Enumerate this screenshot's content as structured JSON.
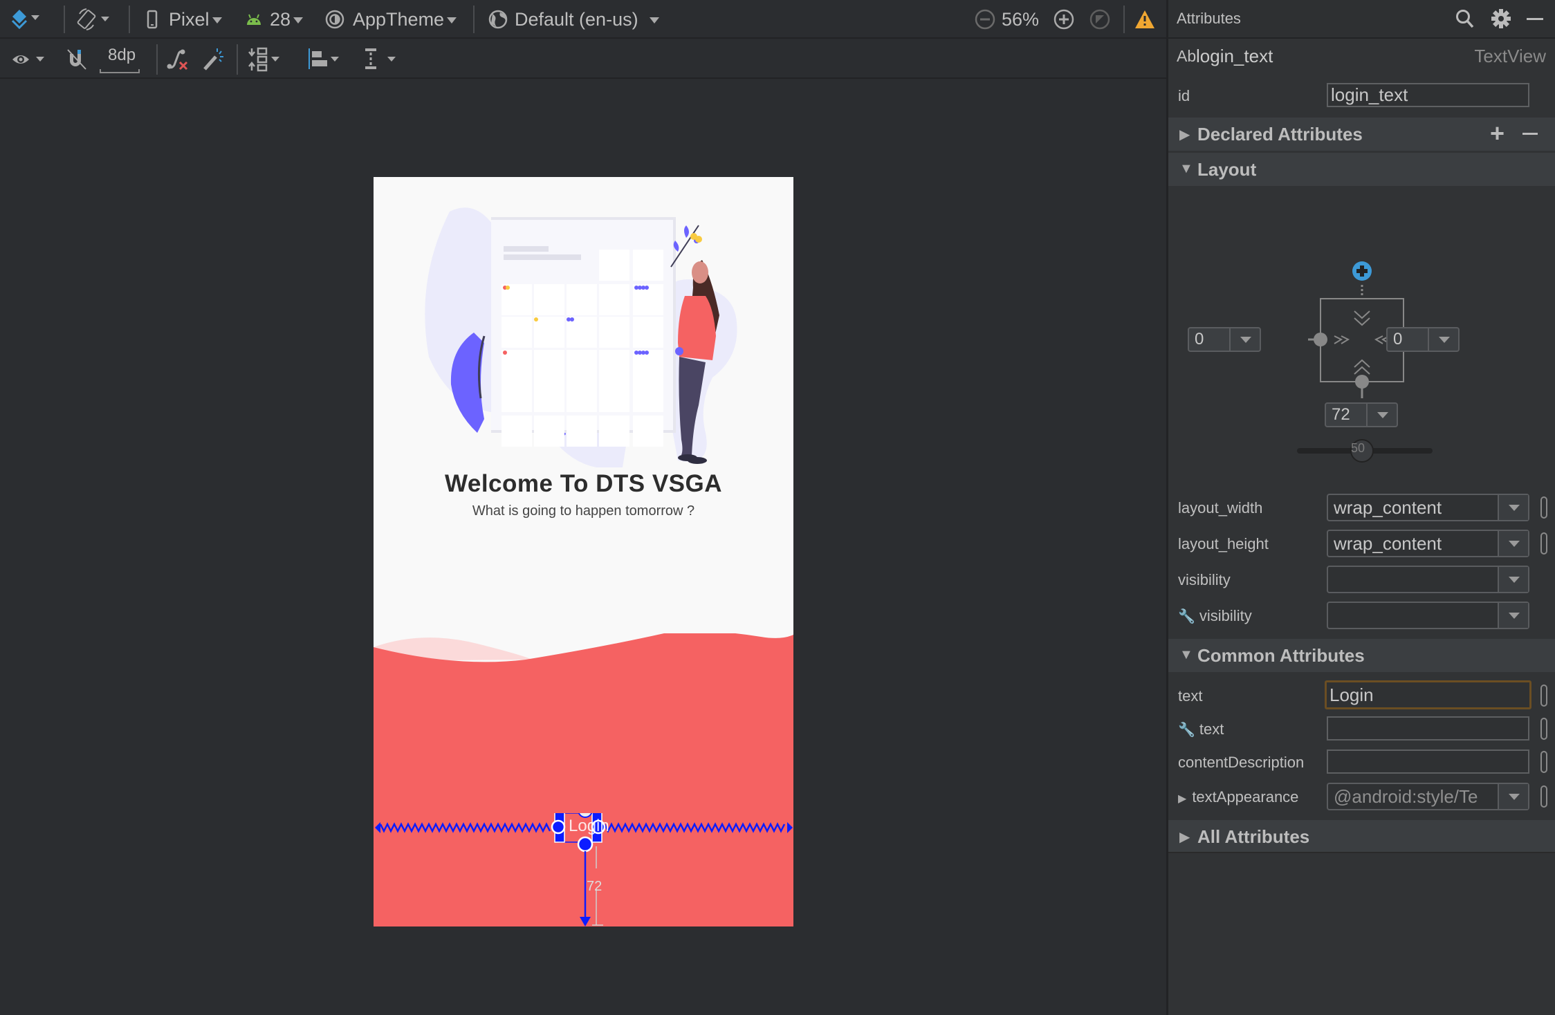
{
  "toolbar": {
    "device": "Pixel",
    "api_level": "28",
    "theme": "AppTheme",
    "locale": "Default (en-us)",
    "zoom": "56%",
    "margin_default": "8dp"
  },
  "attributes_panel": {
    "title": "Attributes",
    "component_prefix": "Ab",
    "component_id": "login_text",
    "component_type": "TextView",
    "id_label": "id",
    "id_value": "login_text",
    "sections": {
      "declared": "Declared Attributes",
      "layout": "Layout",
      "common": "Common Attributes",
      "all": "All Attributes"
    },
    "constraints": {
      "left_margin": "0",
      "right_margin": "0",
      "bottom_margin": "72",
      "horizontal_bias": "50"
    },
    "layout_rows": [
      {
        "label": "layout_width",
        "value": "wrap_content"
      },
      {
        "label": "layout_height",
        "value": "wrap_content"
      },
      {
        "label": "visibility",
        "value": ""
      },
      {
        "label": "visibility",
        "value": "",
        "tools": true
      }
    ],
    "common_rows": [
      {
        "label": "text",
        "value": "Login"
      },
      {
        "label": "text",
        "value": "",
        "tools": true
      },
      {
        "label": "contentDescription",
        "value": ""
      },
      {
        "label": "textAppearance",
        "value": "@android:style/Te"
      }
    ]
  },
  "preview": {
    "title": "Welcome To DTS VSGA",
    "subtitle": "What is going to happen tomorrow ?",
    "selected_text": "Login",
    "bottom_margin_label": "72",
    "colors": {
      "wave": "#f56262",
      "wave_light": "#fbdada",
      "accent": "#6c63ff",
      "selection": "#0c1cff"
    }
  },
  "colors": {
    "accent_blue": "#3d9ad7",
    "warning": "#f0a732",
    "android_green": "#7bbd4c",
    "focus_border": "#6b4e23"
  }
}
